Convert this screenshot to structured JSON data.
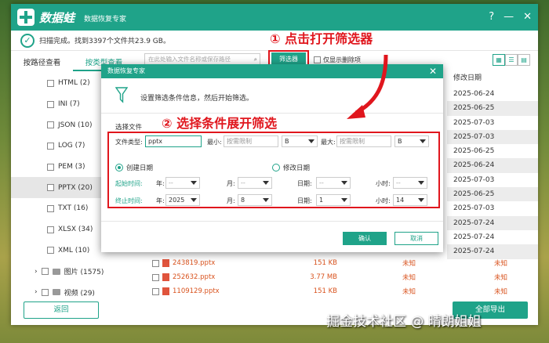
{
  "app": {
    "brand": "数据蛙",
    "subtitle": "数据恢复专家",
    "status": "扫描完成。找到3397个文件共23.9 GB。"
  },
  "titlebar_icons": {
    "help": "?",
    "minimize": "—",
    "close": "✕"
  },
  "sidebar": {
    "tabs": [
      "按路径查看",
      "按类型查看"
    ],
    "items": [
      {
        "label": "HTML (2)"
      },
      {
        "label": "INI (7)"
      },
      {
        "label": "JSON (10)"
      },
      {
        "label": "LOG (7)"
      },
      {
        "label": "PEM (3)"
      },
      {
        "label": "PPTX (20)"
      },
      {
        "label": "TXT (16)"
      },
      {
        "label": "XLSX (34)"
      },
      {
        "label": "XML (10)"
      },
      {
        "label": "图片 (1575)"
      },
      {
        "label": "视频 (29)"
      }
    ]
  },
  "toolbar": {
    "search_placeholder": "在此处输入文件名称或保存路径",
    "filter_label": "筛选器",
    "delete_only_label": "仅显示删除项"
  },
  "date_column": {
    "header": "修改日期",
    "values": [
      "2025-06-24",
      "2025-06-25",
      "2025-07-03",
      "2025-07-03",
      "2025-06-25",
      "2025-06-24",
      "2025-07-03",
      "2025-06-25",
      "2025-07-03",
      "2025-07-24",
      "2025-07-24",
      "2025-07-24"
    ]
  },
  "files": [
    {
      "name": "243819.pptx",
      "size": "151 KB",
      "c1": "未知",
      "c2": "未知"
    },
    {
      "name": "252632.pptx",
      "size": "3.77 MB",
      "c1": "未知",
      "c2": "未知"
    },
    {
      "name": "1109129.pptx",
      "size": "151 KB",
      "c1": "未知",
      "c2": "未知"
    }
  ],
  "buttons": {
    "back": "返回",
    "recover": "全部导出"
  },
  "dialog": {
    "title": "数据恢复专家",
    "info": "设置筛选条件信息，然后开始筛选。",
    "section": "选择文件",
    "file_type_label": "文件类型:",
    "file_type_value": "pptx",
    "min_label": "最小:",
    "min_placeholder": "按需限制",
    "min_unit": "B",
    "max_label": "最大:",
    "max_placeholder": "按需限制",
    "max_unit": "B",
    "radio_created": "创建日期",
    "radio_modified": "修改日期",
    "start_label": "起始时间:",
    "end_label": "终止时间:",
    "year": "年:",
    "month": "月:",
    "day": "日期:",
    "hour": "小时:",
    "dash": "--",
    "end_year": "2025",
    "end_month": "8",
    "end_day": "1",
    "end_hour": "14",
    "ok": "确认",
    "cancel": "取消"
  },
  "annotations": {
    "step1": "① 点击打开筛选器",
    "step2": "② 选择条件展开筛选"
  },
  "watermark": "掘金技术社区 @ 晴朗姐姐",
  "colors": {
    "accent": "#1fa389",
    "annotation_red": "#e0161d"
  }
}
